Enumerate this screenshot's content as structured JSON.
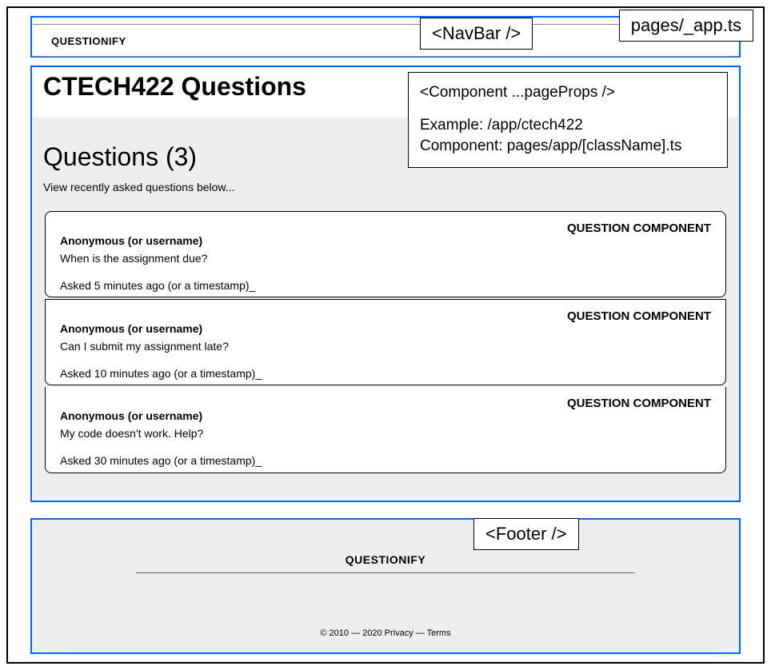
{
  "app_file_label": "pages/_app.ts",
  "navbar": {
    "brand": "QUESTIONIFY",
    "tag": "<NavBar />"
  },
  "main": {
    "page_title": "CTECH422 Questions",
    "component_box": {
      "line1": "<Component ...pageProps />",
      "line2": "Example: /app/ctech422",
      "line3": "Component: pages/app/[className].ts"
    },
    "section_title": "Questions (3)",
    "section_sub": "View recently asked questions below...",
    "question_component_label": "QUESTION COMPONENT",
    "questions": [
      {
        "author": "Anonymous (or username)",
        "text": "When is the assignment due?",
        "time": "Asked 5 minutes ago (or a timestamp)_"
      },
      {
        "author": "Anonymous (or username)",
        "text": "Can I submit my assignment late?",
        "time": "Asked 10 minutes ago (or a timestamp)_"
      },
      {
        "author": "Anonymous (or username)",
        "text": "My code doesn't work. Help?",
        "time": "Asked 30 minutes ago (or a timestamp)_"
      }
    ]
  },
  "footer": {
    "tag": "<Footer />",
    "brand": "QUESTIONIFY",
    "legal": "© 2010 — 2020   Privacy — Terms"
  }
}
